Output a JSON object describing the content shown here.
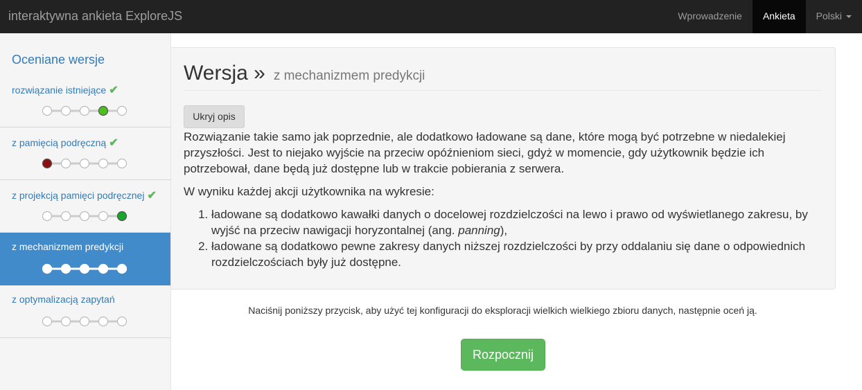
{
  "navbar": {
    "brand": "interaktywna ankieta ExploreJS",
    "links": [
      {
        "label": "Wprowadzenie",
        "active": false
      },
      {
        "label": "Ankieta",
        "active": true
      },
      {
        "label": "Polski",
        "active": false,
        "dropdown": true
      }
    ]
  },
  "sidebar": {
    "title": "Oceniane wersje",
    "items": [
      {
        "label": "rozwiązanie istniejące",
        "checked": true,
        "rating": 4,
        "rating_color": "#4cc01d",
        "active": false
      },
      {
        "label": "z pamięcią podręczną",
        "checked": true,
        "rating": 1,
        "rating_color": "#8b0f0f",
        "active": false
      },
      {
        "label": "z projekcją pamięci podręcznej",
        "checked": true,
        "rating": 5,
        "rating_color": "#17a52a",
        "active": false
      },
      {
        "label": "z mechanizmem predykcji",
        "checked": false,
        "rating": 0,
        "rating_color": "#ffffff",
        "active": true
      },
      {
        "label": "z optymalizacją zapytań",
        "checked": false,
        "rating": 0,
        "rating_color": "#ffffff",
        "active": false
      }
    ],
    "rating_scale_max": 5
  },
  "panel": {
    "title": "Wersja »",
    "subtitle": "z mechanizmem predykcji",
    "hide_button": "Ukryj opis",
    "paragraph1": "Rozwiązanie takie samo jak poprzednie, ale dodatkowo ładowane są dane, które mogą być potrzebne w niedalekiej przyszłości. Jest to niejako wyjście na przeciw opóźnieniom sieci, gdyż w momencie, gdy użytkownik będzie ich potrzebował, dane będą już dostępne lub w trakcie pobierania z serwera.",
    "paragraph2": "W wyniku każdej akcji użytkownika na wykresie:",
    "list": [
      {
        "before": "ładowane są dodatkowo kawałki danych o docelowej rozdzielczości na lewo i prawo od wyświetlanego zakresu, by wyjść na przeciw nawigacji horyzontalnej (ang. ",
        "em": "panning",
        "after": "),"
      },
      {
        "before": "ładowane są dodatkowo pewne zakresy danych niższej rozdzielczości by przy oddalaniu się dane o odpowiednich rozdzielczościach były już dostępne.",
        "em": "",
        "after": ""
      }
    ]
  },
  "note": "Naciśnij poniższy przycisk, aby użyć tej konfiguracji do eksploracji wielkich wielkiego zbioru danych, następnie oceń ją.",
  "start_button": "Rozpocznij",
  "colors": {
    "navbar_bg": "#222222",
    "link": "#337ab7",
    "active_item": "#428bca",
    "success": "#5cb85c"
  }
}
